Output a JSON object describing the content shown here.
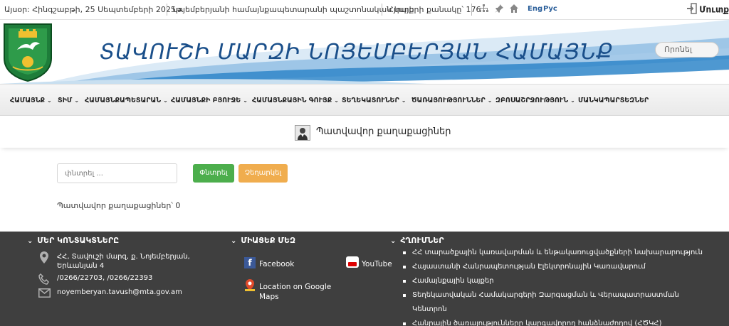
{
  "topbar": {
    "date_text": "Այսօր: Հինգշաբթի, 25 Սեպտեմբերի 2025թ.",
    "official_site": "Նոյեմբերյանի համայնքապետարանի պաշտոնական կայք",
    "visitors": "Հյուրերի քանակը՝ 176",
    "lang_en": "Eng",
    "lang_ru": "Рус",
    "login": "Մուտք"
  },
  "header": {
    "title": "ՏԱՎՈՒՇԻ ՄԱՐԶԻ ՆՈՅԵՄԲԵՐՅԱՆ ՀԱՄԱՅՆՔ",
    "search_placeholder": "Որոնել"
  },
  "nav": {
    "items": [
      "ՀԱՄԱՅՆՔ",
      "ՏԻՄ",
      "ՀԱՄԱՅՆՔԱՊԵՏԱՐԱՆ",
      "ՀԱՄԱՅՆՔԻ ԲՅՈՒՋԵ",
      "ՀԱՄԱՅՆՔԱՅԻՆ ԳՈՒՅՔ",
      "ՏԵՂԵԿԱՏՈՒՆԵՐ",
      "ԾԱՌԱՅՈՒԹՅՈՒՆՆԵՐ",
      "ԶԲՈՍԱՇՐՋՈՒԹՅՈՒՆ",
      "ՄԱՆԿԱՊԱՐՏԵԶՆԵՐ"
    ]
  },
  "page": {
    "title": "Պատվավոր քաղաքացիներ",
    "search_placeholder": "փնտրել ...",
    "search_button": "Փնտրել",
    "cancel_button": "Չեղարկել",
    "count_text": "Պատվավոր քաղաքացիներ՝ 0"
  },
  "footer": {
    "contacts": {
      "heading": "ՄԵՐ ԿՈՆՏԱԿՏՆԵՐԸ",
      "address": "ՀՀ, Տավուշի մարզ, ք. Նոյեմբերյան, Երևանյան 4",
      "phone": "/0266/22703, /0266/22393",
      "email": "noyemberyan.tavush@mta.gov.am"
    },
    "social": {
      "heading": "ՄԻԱՑԵՔ ՄԵԶ",
      "facebook": "Facebook",
      "youtube": "YouTube",
      "maps": "Location on Google Maps"
    },
    "links": {
      "heading": "ՀՂՈՒՄՆԵՐ",
      "items": [
        "ՀՀ տարածքային կառավարման և ենթակառուցվածքների նախարարություն",
        "Հայաստանի Հանրապետության Էլեկտրոնային Կառավարում",
        "Համայնքային կայքեր",
        "Տեղեկատվական Համակարգերի Զարգացման և Վերապատրաստման Կենտրոն",
        "Հանրային ծառայությունները կարգավորող հանձնաժողով (ՀԾԿՀ)"
      ]
    }
  },
  "colors": {
    "title_blue": "#1a4f8a",
    "search_green": "#4cae4c",
    "cancel_orange": "#f0ad4e",
    "footer_bg": "#3f3f3f"
  }
}
